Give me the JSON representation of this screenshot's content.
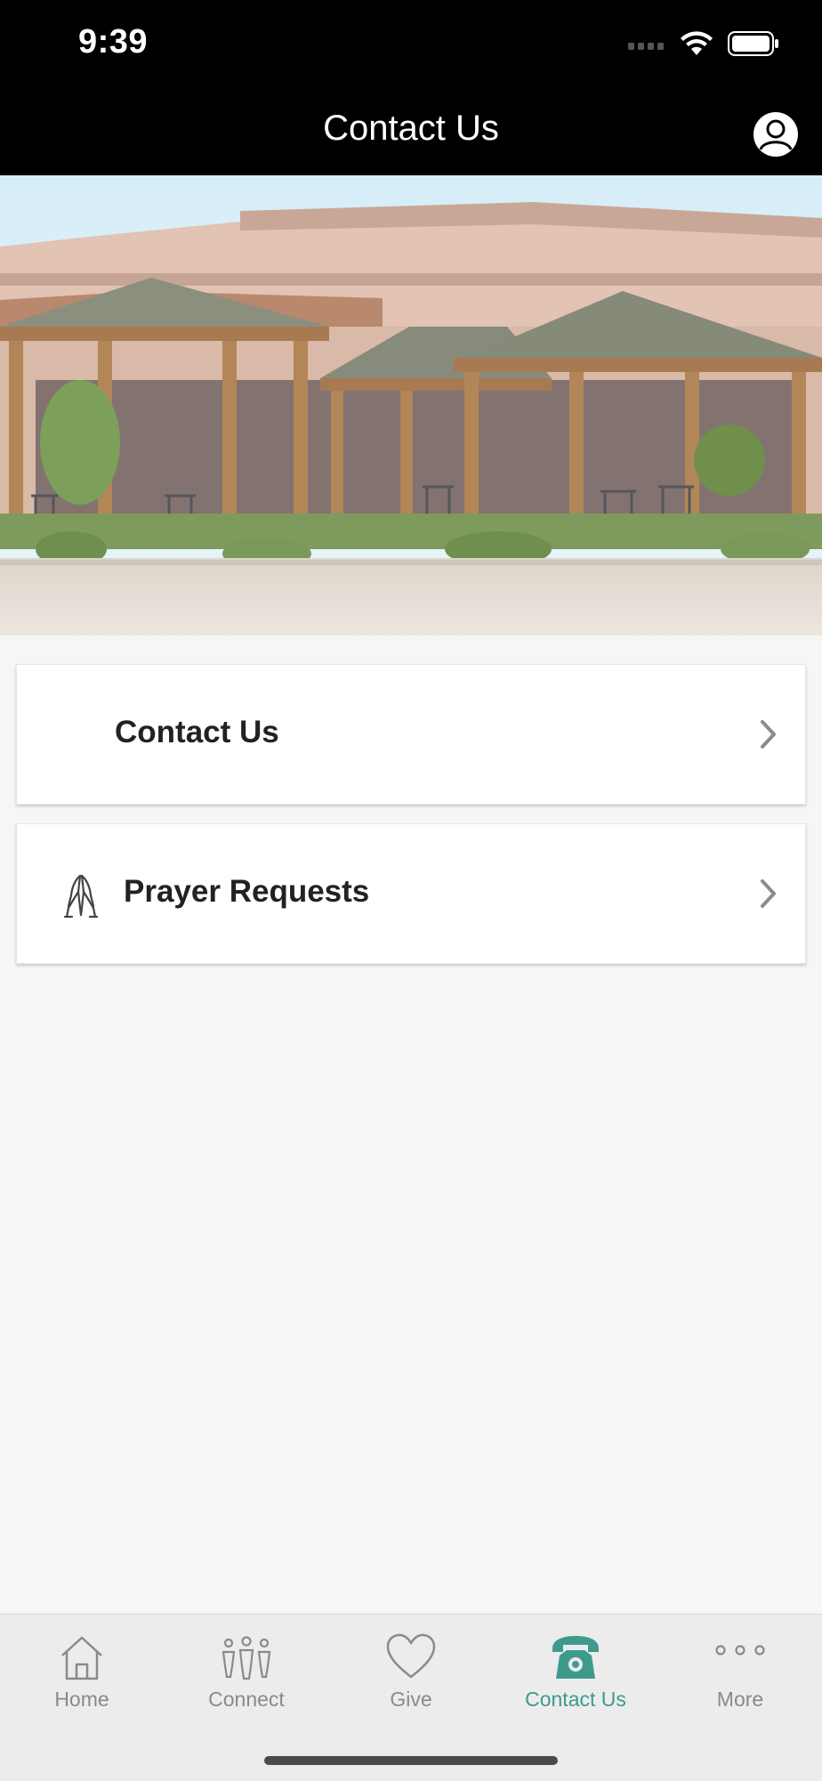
{
  "status": {
    "time": "9:39"
  },
  "header": {
    "title": "Contact Us"
  },
  "cards": [
    {
      "label": "Contact Us"
    },
    {
      "label": "Prayer Requests",
      "icon": "praying-hands-icon"
    }
  ],
  "tabs": [
    {
      "label": "Home",
      "icon": "home-icon"
    },
    {
      "label": "Connect",
      "icon": "people-icon"
    },
    {
      "label": "Give",
      "icon": "heart-icon"
    },
    {
      "label": "Contact Us",
      "icon": "phone-icon",
      "active": true
    },
    {
      "label": "More",
      "icon": "more-dots-icon"
    }
  ],
  "colors": {
    "accent": "#3e9a8c",
    "inactive": "#8a8a8a",
    "bar": "#000000"
  }
}
